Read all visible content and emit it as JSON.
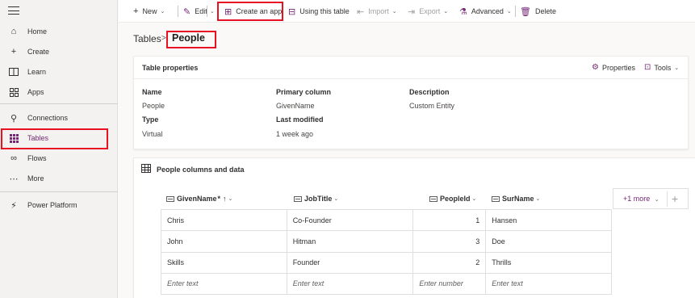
{
  "sidebar": {
    "items": [
      {
        "label": "Home",
        "icon": "home-icon"
      },
      {
        "label": "Create",
        "icon": "plus-icon"
      },
      {
        "label": "Learn",
        "icon": "book-icon"
      },
      {
        "label": "Apps",
        "icon": "apps-icon"
      },
      {
        "label": "Connections",
        "icon": "connections-icon"
      },
      {
        "label": "Tables",
        "icon": "table-grid-icon"
      },
      {
        "label": "Flows",
        "icon": "flows-icon"
      },
      {
        "label": "More",
        "icon": "ellipsis-icon"
      },
      {
        "label": "Power Platform",
        "icon": "power-platform-icon"
      }
    ],
    "active": "Tables"
  },
  "toolbar": {
    "new_label": "New",
    "edit_label": "Edit",
    "create_app_label": "Create an app",
    "using_table_label": "Using this table",
    "import_label": "Import",
    "export_label": "Export",
    "advanced_label": "Advanced",
    "delete_label": "Delete"
  },
  "breadcrumb": {
    "root": "Tables",
    "separator": ">",
    "current": "People"
  },
  "table_properties": {
    "title": "Table properties",
    "properties_button": "Properties",
    "tools_button": "Tools",
    "fields": {
      "name_label": "Name",
      "name_value": "People",
      "type_label": "Type",
      "type_value": "Virtual",
      "primary_column_label": "Primary column",
      "primary_column_value": "GivenName",
      "last_modified_label": "Last modified",
      "last_modified_value": "1 week ago",
      "description_label": "Description",
      "description_value": "Custom Entity"
    }
  },
  "data_section": {
    "title": "People columns and data",
    "columns": [
      {
        "label": "GivenName",
        "required": "*",
        "sort": "↑"
      },
      {
        "label": "JobTitle"
      },
      {
        "label": "PeopleId"
      },
      {
        "label": "SurName"
      }
    ],
    "rows": [
      [
        "Chris",
        "Co-Founder",
        "1",
        "Hansen"
      ],
      [
        "John",
        "Hitman",
        "3",
        "Doe"
      ],
      [
        "Skills",
        "Founder",
        "2",
        "Thrills"
      ]
    ],
    "placeholders": [
      "Enter text",
      "Enter text",
      "Enter number",
      "Enter text"
    ],
    "more_columns_label": "+1 more",
    "add_column_symbol": "+"
  },
  "colors": {
    "accent": "#742774",
    "highlight_box": "#e81123"
  }
}
